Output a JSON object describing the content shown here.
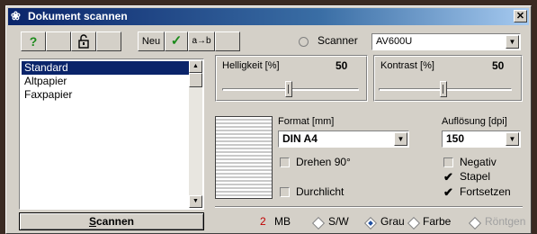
{
  "window": {
    "title": "Dokument scannen",
    "close_label": "✕"
  },
  "toolbar": {
    "help_label": "?",
    "new_label": "Neu",
    "ok_label": "✓",
    "rename_label": "a→b"
  },
  "scanner": {
    "label": "Scanner",
    "value": "AV600U"
  },
  "profiles": {
    "items": [
      "Standard",
      "Altpapier",
      "Faxpapier"
    ],
    "selected": "Standard"
  },
  "scan_button": {
    "label_first": "S",
    "label_rest": "cannen"
  },
  "brightness": {
    "label": "Helligkeit [%]",
    "value": "50",
    "level": 0.5
  },
  "contrast": {
    "label": "Kontrast [%]",
    "value": "50",
    "level": 0.5
  },
  "format": {
    "label": "Format [mm]",
    "value": "DIN A4"
  },
  "resolution": {
    "label": "Auflösung [dpi]",
    "value": "150"
  },
  "options": {
    "rotate": {
      "label": "Drehen 90°",
      "checked": false
    },
    "transmitted": {
      "label": "Durchlicht",
      "checked": false
    },
    "negative": {
      "label": "Negativ",
      "checked": false
    },
    "stack": {
      "label": "Stapel",
      "checked": true
    },
    "continue": {
      "label": "Fortsetzen",
      "checked": true
    }
  },
  "size": {
    "value": "2",
    "unit": "MB",
    "value_color": "#c00000"
  },
  "color_modes": [
    {
      "label": "S/W",
      "selected": false,
      "enabled": true
    },
    {
      "label": "Grau",
      "selected": true,
      "enabled": true
    },
    {
      "label": "Farbe",
      "selected": false,
      "enabled": true
    },
    {
      "label": "Röntgen",
      "selected": false,
      "enabled": false
    }
  ],
  "colors": {
    "titlebar": "#0a246a",
    "face": "#d4d0c8",
    "selection": "#0a246a",
    "check_green": "#1a8a1a"
  }
}
